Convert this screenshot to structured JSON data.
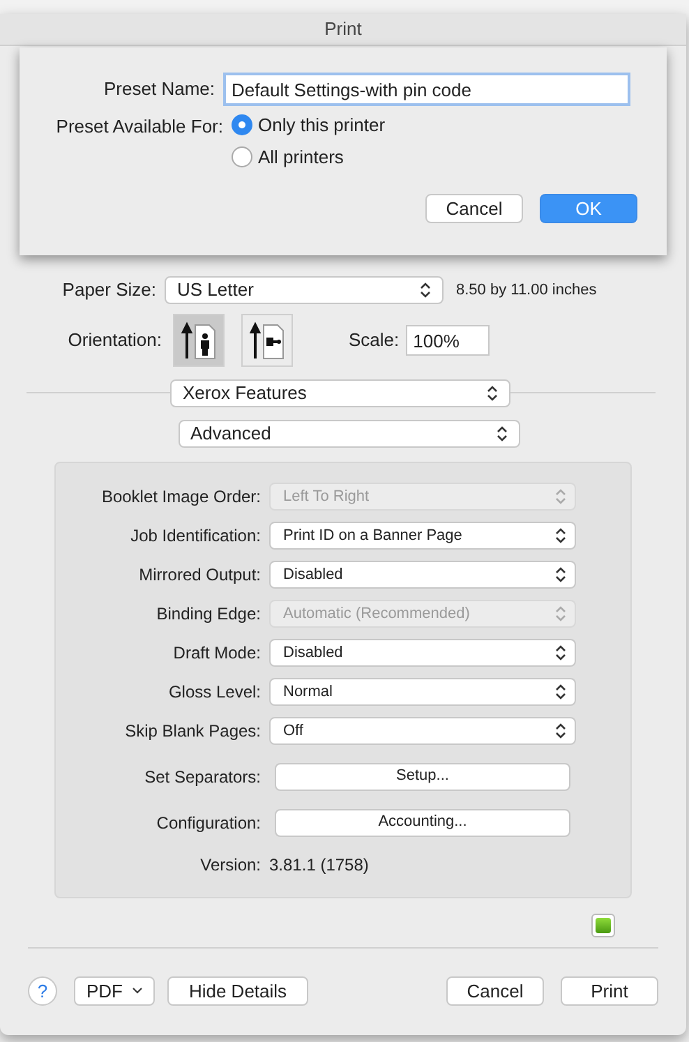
{
  "window": {
    "title": "Print"
  },
  "sheet": {
    "preset_name": {
      "label": "Preset Name:",
      "value": "Default Settings-with pin code"
    },
    "available_for": {
      "label": "Preset Available For:",
      "options": [
        {
          "label": "Only this printer",
          "selected": true
        },
        {
          "label": "All printers",
          "selected": false
        }
      ]
    },
    "buttons": [
      {
        "label": "Cancel",
        "default": false
      },
      {
        "label": "OK",
        "default": true
      }
    ]
  },
  "paper_size": {
    "label": "Paper Size:",
    "value": "US Letter",
    "dimensions": "8.50 by 11.00 inches"
  },
  "orientation": {
    "label": "Orientation:",
    "options": [
      {
        "kind": "portrait",
        "selected": true
      },
      {
        "kind": "landscape",
        "selected": false
      }
    ]
  },
  "scale": {
    "label": "Scale:",
    "value": "100%"
  },
  "section_menu": "Xerox Features",
  "subsection_menu": "Advanced",
  "settings": [
    {
      "kind": "popup",
      "label": "Booklet Image Order:",
      "value": "Left To Right",
      "disabled": true
    },
    {
      "kind": "popup",
      "label": "Job Identification:",
      "value": "Print ID on a Banner Page",
      "disabled": false
    },
    {
      "kind": "popup",
      "label": "Mirrored Output:",
      "value": "Disabled",
      "disabled": false
    },
    {
      "kind": "popup",
      "label": "Binding Edge:",
      "value": "Automatic (Recommended)",
      "disabled": true
    },
    {
      "kind": "popup",
      "label": "Draft Mode:",
      "value": "Disabled",
      "disabled": false
    },
    {
      "kind": "popup",
      "label": "Gloss Level:",
      "value": "Normal",
      "disabled": false
    },
    {
      "kind": "popup",
      "label": "Skip Blank Pages:",
      "value": "Off",
      "disabled": false
    },
    {
      "kind": "button",
      "label": "Set Separators:",
      "value": "Setup..."
    },
    {
      "kind": "button",
      "label": "Configuration:",
      "value": "Accounting..."
    },
    {
      "kind": "text",
      "label": "Version:",
      "value": "3.81.1 (1758)"
    }
  ],
  "footer": {
    "help": "?",
    "pdf": "PDF",
    "details": "Hide Details",
    "buttons": [
      "Cancel",
      "Print"
    ]
  }
}
